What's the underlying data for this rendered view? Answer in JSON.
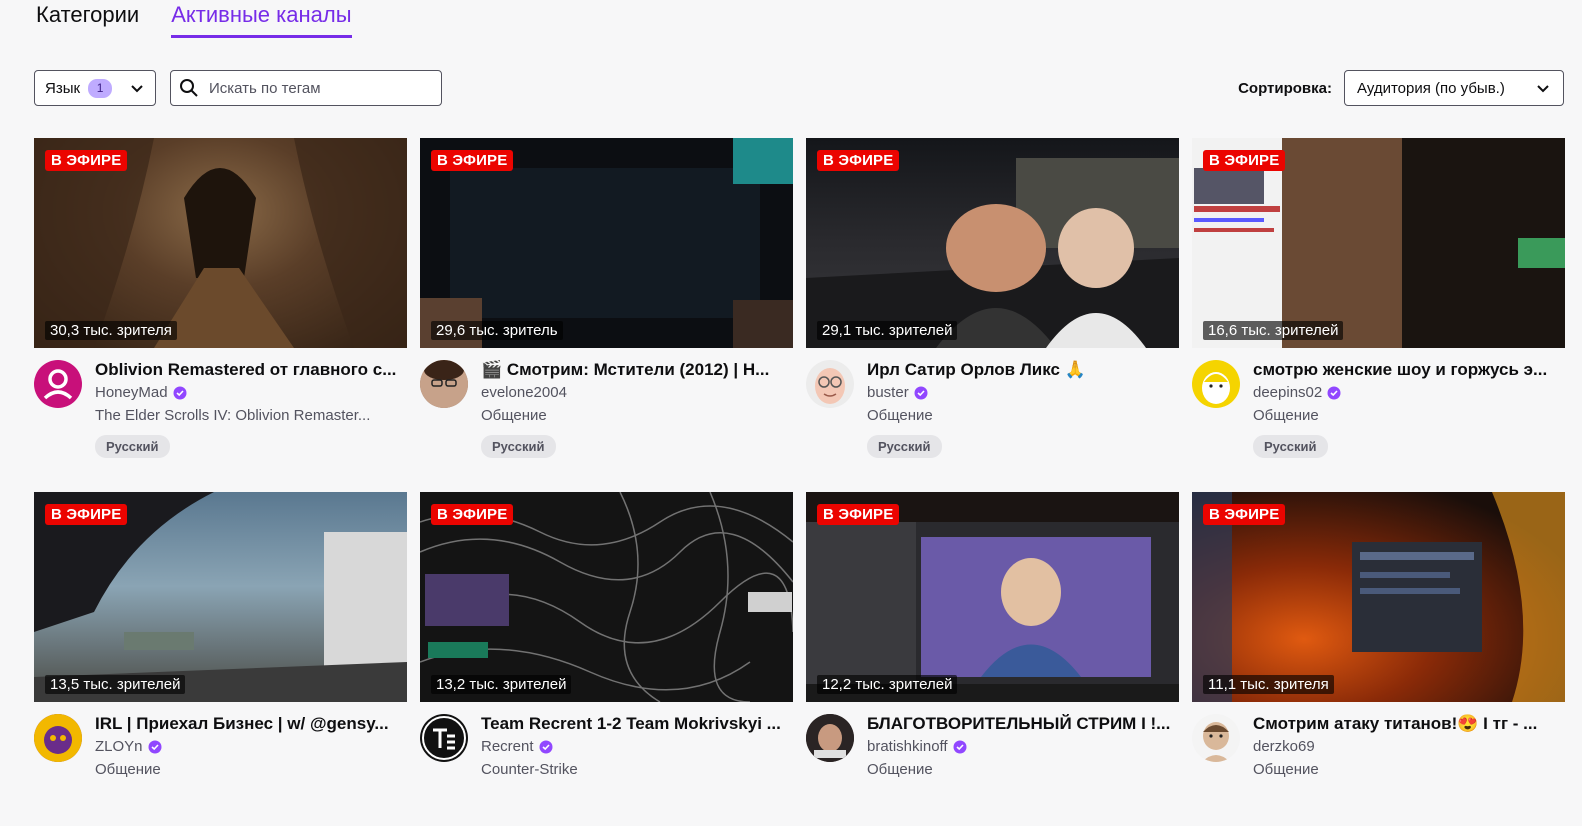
{
  "tabs": [
    {
      "label": "Категории",
      "active": false
    },
    {
      "label": "Активные каналы",
      "active": true
    }
  ],
  "filters": {
    "language_label": "Язык",
    "language_count": "1",
    "search_placeholder": "Искать по тегам",
    "sort_label": "Сортировка:",
    "sort_value": "Аудитория (по убыв.)"
  },
  "live_label": "В ЭФИРЕ",
  "streams": [
    {
      "title": "Oblivion Remastered от главного с...",
      "channel": "HoneyMad",
      "category": "The Elder Scrolls IV: Oblivion Remaster...",
      "viewers": "30,3 тыс. зрителя",
      "tag": "Русский",
      "accent": "#c8107a"
    },
    {
      "title": "🎬 Смотрим: Мстители (2012) | Н...",
      "channel": "evelone2004",
      "category": "Общение",
      "viewers": "29,6 тыс. зритель",
      "tag": "Русский",
      "accent": "#8a6a55"
    },
    {
      "title": "Ирл Сатир Орлов Ликс 🙏",
      "channel": "buster",
      "category": "Общение",
      "viewers": "29,1 тыс. зрителей",
      "tag": "Русский",
      "accent": "#e8d8c8"
    },
    {
      "title": "смотрю женские шоу и горжусь э...",
      "channel": "deepins02",
      "category": "Общение",
      "viewers": "16,6 тыс. зрителей",
      "tag": "Русский",
      "accent": "#f5d400"
    },
    {
      "title": "IRL | Приехал Бизнес | w/ @gensy...",
      "channel": "ZLOYn",
      "category": "Общение",
      "viewers": "13,5 тыс. зрителей",
      "tag": "",
      "accent": "#6a2c8a"
    },
    {
      "title": "Team Recrent 1-2 Team Mokrivskyi ...",
      "channel": "Recrent",
      "category": "Counter-Strike",
      "viewers": "13,2 тыс. зрителей",
      "tag": "",
      "accent": "#111111"
    },
    {
      "title": "БЛАГОТВОРИТЕЛЬНЫЙ СТРИМ I !...",
      "channel": "bratishkinoff",
      "category": "Общение",
      "viewers": "12,2 тыс. зрителей",
      "tag": "",
      "accent": "#3a2a2a"
    },
    {
      "title": "Смотрим атаку титанов!😍 I тг - ...",
      "channel": "derzko69",
      "category": "Общение",
      "viewers": "11,1 тыс. зрителя",
      "tag": "",
      "accent": "#d9b89a"
    }
  ]
}
